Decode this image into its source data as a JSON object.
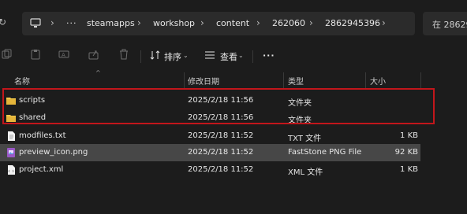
{
  "addressbar": {
    "crumbs": [
      "steamapps",
      "workshop",
      "content",
      "262060",
      "2862945396"
    ],
    "more": "···",
    "search_placeholder": "在 28629"
  },
  "toolbar": {
    "sort_label": "排序",
    "view_label": "查看",
    "more_label": "···"
  },
  "columns": {
    "name": "名称",
    "date": "修改日期",
    "type": "类型",
    "size": "大小"
  },
  "files": [
    {
      "name": "scripts",
      "date": "2025/2/18 11:56",
      "type": "文件夹",
      "size": "",
      "icon": "folder-icon"
    },
    {
      "name": "shared",
      "date": "2025/2/18 11:56",
      "type": "文件夹",
      "size": "",
      "icon": "folder-icon"
    },
    {
      "name": "modfiles.txt",
      "date": "2025/2/18 11:52",
      "type": "TXT 文件",
      "size": "1 KB",
      "icon": "text-file-icon"
    },
    {
      "name": "preview_icon.png",
      "date": "2025/2/18 11:52",
      "type": "FastStone PNG File",
      "size": "92 KB",
      "icon": "image-file-icon"
    },
    {
      "name": "project.xml",
      "date": "2025/2/18 11:52",
      "type": "XML 文件",
      "size": "1 KB",
      "icon": "xml-file-icon"
    }
  ],
  "colors": {
    "highlight": "#c2161b",
    "folder": "#f3c94b",
    "selection": "#474747"
  }
}
